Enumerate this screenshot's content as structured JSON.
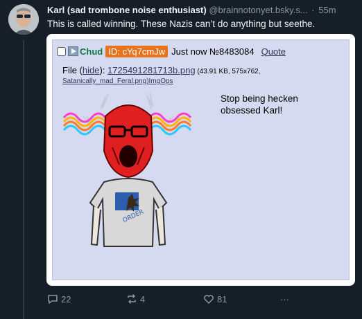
{
  "post": {
    "author": "Karl (sad trombone noise enthusiast)",
    "handle": "@brainnotonyet.bsky.s...",
    "separator": "·",
    "time": "55m",
    "text": "This is called winning. These Nazis can’t do anything but seethe."
  },
  "embed": {
    "name": "Chud",
    "id_label": "ID: cYq7cmJw",
    "timestamp_no": "Just now №8483084",
    "quote_label": "Quote",
    "file_prefix": "File (",
    "hide_label": "hide",
    "file_mid": "): ",
    "file_name": "1725491281713b.png",
    "file_meta": " (43.91 KB, 575x762,",
    "original_name": "Satanically_mad_Feral.png",
    "imgops": ")ImgOps",
    "body": "Stop being hecken obsessed Karl!",
    "shirt_text": "ORDER"
  },
  "actions": {
    "replies": "22",
    "reposts": "4",
    "likes": "81",
    "more": "···"
  },
  "colors": {
    "background": "#161e27",
    "chan_bg": "#d6daf0",
    "name_green": "#117743",
    "id_orange": "#e8731c",
    "face_red": "#e02020"
  }
}
